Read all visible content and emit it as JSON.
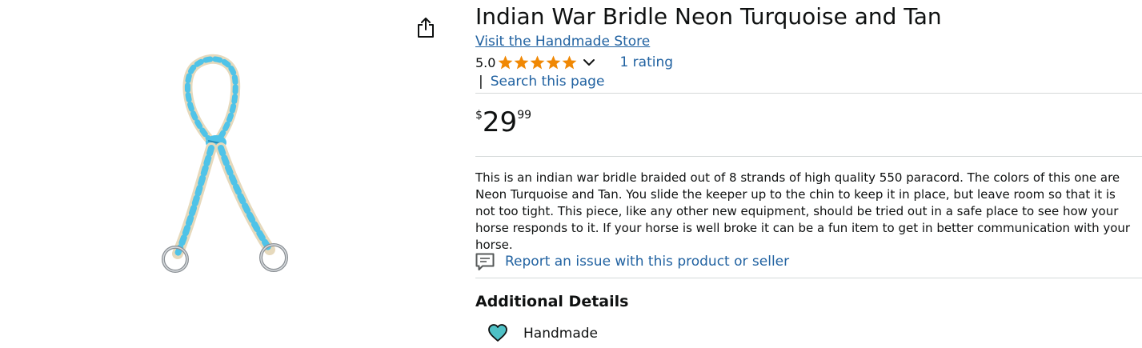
{
  "product": {
    "title": "Indian War Bridle Neon Turquoise and Tan",
    "store_link": "Visit the Handmade Store",
    "rating_value": "5.0",
    "rating_stars": 5,
    "rating_count": "1 rating",
    "search_separator": "|",
    "search_page": "Search this page",
    "price": {
      "symbol": "$",
      "whole": "29",
      "fraction": "99"
    },
    "description": "This is an indian war bridle braided out of 8 strands of high quality 550 paracord. The colors of this one are Neon Turquoise and Tan. You slide the keeper up to the chin to keep it in place, but leave room so that it is not too tight. This piece, like any other new equipment, should be tried out in a safe place to see how your horse responds to it. If your horse is well broke it can be a fun item to get in better communication with your horse.",
    "report_link": "Report an issue with this product or seller",
    "additional_details_heading": "Additional Details",
    "handmade_label": "Handmade"
  },
  "icons": {
    "share": "share-icon",
    "star": "star-icon",
    "chevron": "chevron-down-icon",
    "report": "report-icon",
    "handmade": "heart-icon"
  },
  "colors": {
    "link": "#2162A1",
    "star": "#F08804",
    "text": "#0F1111",
    "divider": "#D5D9D9",
    "product_blue": "#4FC3E8",
    "product_tan": "#E6D9BC",
    "heart_teal": "#4FC1C6"
  }
}
